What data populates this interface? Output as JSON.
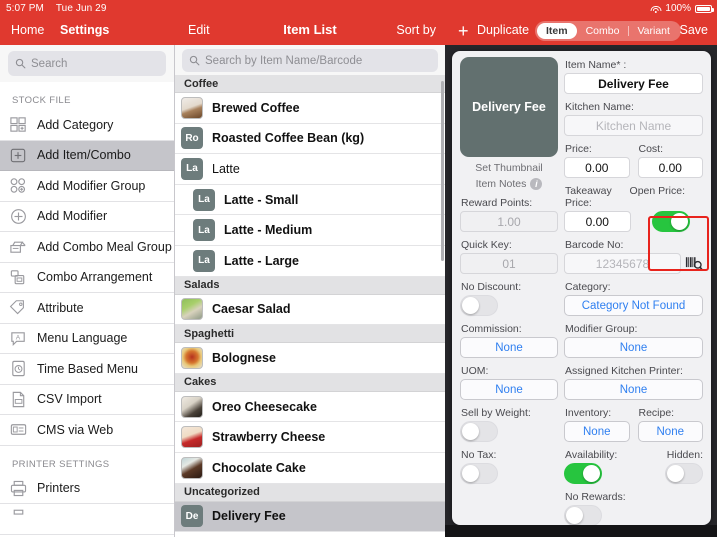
{
  "statusbar": {
    "time": "5:07 PM",
    "date": "Tue Jun 29",
    "battery": "100%"
  },
  "navbar": {
    "home": "Home",
    "settings": "Settings",
    "edit": "Edit",
    "title": "Item List",
    "sort_by": "Sort by",
    "plus": "+",
    "duplicate": "Duplicate",
    "segments": [
      {
        "label": "Item",
        "active": true
      },
      {
        "label": "Combo",
        "active": false
      },
      {
        "label": "Variant",
        "active": false
      }
    ],
    "save": "Save"
  },
  "sidebar": {
    "search_placeholder": "Search",
    "sections": [
      {
        "header": "STOCK FILE",
        "items": [
          {
            "label": "Add Category",
            "icon": "add-category-icon",
            "selected": false
          },
          {
            "label": "Add Item/Combo",
            "icon": "add-item-icon",
            "selected": true
          },
          {
            "label": "Add Modifier Group",
            "icon": "add-modifier-group-icon",
            "selected": false
          },
          {
            "label": "Add Modifier",
            "icon": "add-modifier-icon",
            "selected": false
          },
          {
            "label": "Add Combo Meal Group",
            "icon": "combo-meal-group-icon",
            "selected": false
          },
          {
            "label": "Combo Arrangement",
            "icon": "combo-arrangement-icon",
            "selected": false
          },
          {
            "label": "Attribute",
            "icon": "tag-icon",
            "selected": false
          },
          {
            "label": "Menu Language",
            "icon": "menu-language-icon",
            "selected": false
          },
          {
            "label": "Time Based Menu",
            "icon": "clock-menu-icon",
            "selected": false
          },
          {
            "label": "CSV Import",
            "icon": "csv-import-icon",
            "selected": false
          },
          {
            "label": "CMS via Web",
            "icon": "cms-web-icon",
            "selected": false
          }
        ]
      },
      {
        "header": "PRINTER SETTINGS",
        "items": [
          {
            "label": "Printers",
            "icon": "printer-icon",
            "selected": false
          }
        ]
      }
    ]
  },
  "item_list": {
    "search_placeholder": "Search by Item Name/Barcode",
    "groups": [
      {
        "header": "Coffee",
        "items": [
          {
            "name": "Brewed Coffee",
            "thumb_type": "photo",
            "thumb_text": "",
            "child": false,
            "bold": true,
            "selected": false,
            "photo": "coffee-cup-photo"
          },
          {
            "name": "Roasted Coffee Bean (kg)",
            "thumb_type": "initials",
            "thumb_text": "Ro",
            "child": false,
            "bold": true,
            "selected": false
          },
          {
            "name": "Latte",
            "thumb_type": "initials",
            "thumb_text": "La",
            "child": false,
            "bold": false,
            "selected": false
          },
          {
            "name": "Latte - Small",
            "thumb_type": "initials",
            "thumb_text": "La",
            "child": true,
            "bold": true,
            "selected": false
          },
          {
            "name": "Latte - Medium",
            "thumb_type": "initials",
            "thumb_text": "La",
            "child": true,
            "bold": true,
            "selected": false
          },
          {
            "name": "Latte - Large",
            "thumb_type": "initials",
            "thumb_text": "La",
            "child": true,
            "bold": true,
            "selected": false
          }
        ]
      },
      {
        "header": "Salads",
        "items": [
          {
            "name": "Caesar Salad",
            "thumb_type": "photo",
            "thumb_text": "",
            "child": false,
            "bold": true,
            "selected": false,
            "photo": "salad-photo"
          }
        ]
      },
      {
        "header": "Spaghetti",
        "items": [
          {
            "name": "Bolognese",
            "thumb_type": "photo",
            "thumb_text": "",
            "child": false,
            "bold": true,
            "selected": false,
            "photo": "spaghetti-photo"
          }
        ]
      },
      {
        "header": "Cakes",
        "items": [
          {
            "name": "Oreo Cheesecake",
            "thumb_type": "photo",
            "thumb_text": "",
            "child": false,
            "bold": true,
            "selected": false,
            "photo": "oreo-cheesecake-photo"
          },
          {
            "name": "Strawberry Cheese",
            "thumb_type": "photo",
            "thumb_text": "",
            "child": false,
            "bold": true,
            "selected": false,
            "photo": "strawberry-cheese-photo"
          },
          {
            "name": "Chocolate Cake",
            "thumb_type": "photo",
            "thumb_text": "",
            "child": false,
            "bold": true,
            "selected": false,
            "photo": "chocolate-cake-photo"
          }
        ]
      },
      {
        "header": "Uncategorized",
        "items": [
          {
            "name": "Delivery Fee",
            "thumb_type": "initials",
            "thumb_text": "De",
            "child": false,
            "bold": true,
            "selected": true
          }
        ]
      }
    ]
  },
  "detail": {
    "thumbnail_text": "Delivery Fee",
    "set_thumbnail": "Set Thumbnail",
    "item_notes": "Item Notes",
    "reward_points_label": "Reward Points:",
    "reward_points_value": "1.00",
    "quick_key_label": "Quick Key:",
    "quick_key_value": "01",
    "no_discount_label": "No Discount:",
    "no_discount_on": false,
    "commission_label": "Commission:",
    "commission_value": "None",
    "uom_label": "UOM:",
    "uom_value": "None",
    "sell_by_weight_label": "Sell by Weight:",
    "sell_by_weight_on": false,
    "no_tax_label": "No Tax:",
    "no_tax_on": false,
    "item_name_label": "Item Name* :",
    "item_name_value": "Delivery Fee",
    "kitchen_name_label": "Kitchen Name:",
    "kitchen_name_placeholder": "Kitchen Name",
    "price_label": "Price:",
    "price_value": "0.00",
    "cost_label": "Cost:",
    "cost_value": "0.00",
    "takeaway_price_label": "Takeaway Price:",
    "takeaway_price_value": "0.00",
    "open_price_label": "Open Price:",
    "open_price_on": true,
    "barcode_label": "Barcode No:",
    "barcode_placeholder": "12345678",
    "barcode_scan_icon": "barcode-scan-icon",
    "category_label": "Category:",
    "category_value": "Category Not Found",
    "modifier_group_label": "Modifier Group:",
    "modifier_group_value": "None",
    "assigned_printer_label": "Assigned Kitchen Printer:",
    "assigned_printer_value": "None",
    "inventory_label": "Inventory:",
    "inventory_value": "None",
    "recipe_label": "Recipe:",
    "recipe_value": "None",
    "availability_label": "Availability:",
    "availability_on": true,
    "hidden_label": "Hidden:",
    "hidden_on": false,
    "no_rewards_label": "No Rewards:",
    "no_rewards_on": false
  },
  "colors": {
    "brand_red": "#e0392f",
    "toggle_green": "#27c53f",
    "link_blue": "#2f7ff0",
    "highlight_red": "#e8231c"
  }
}
